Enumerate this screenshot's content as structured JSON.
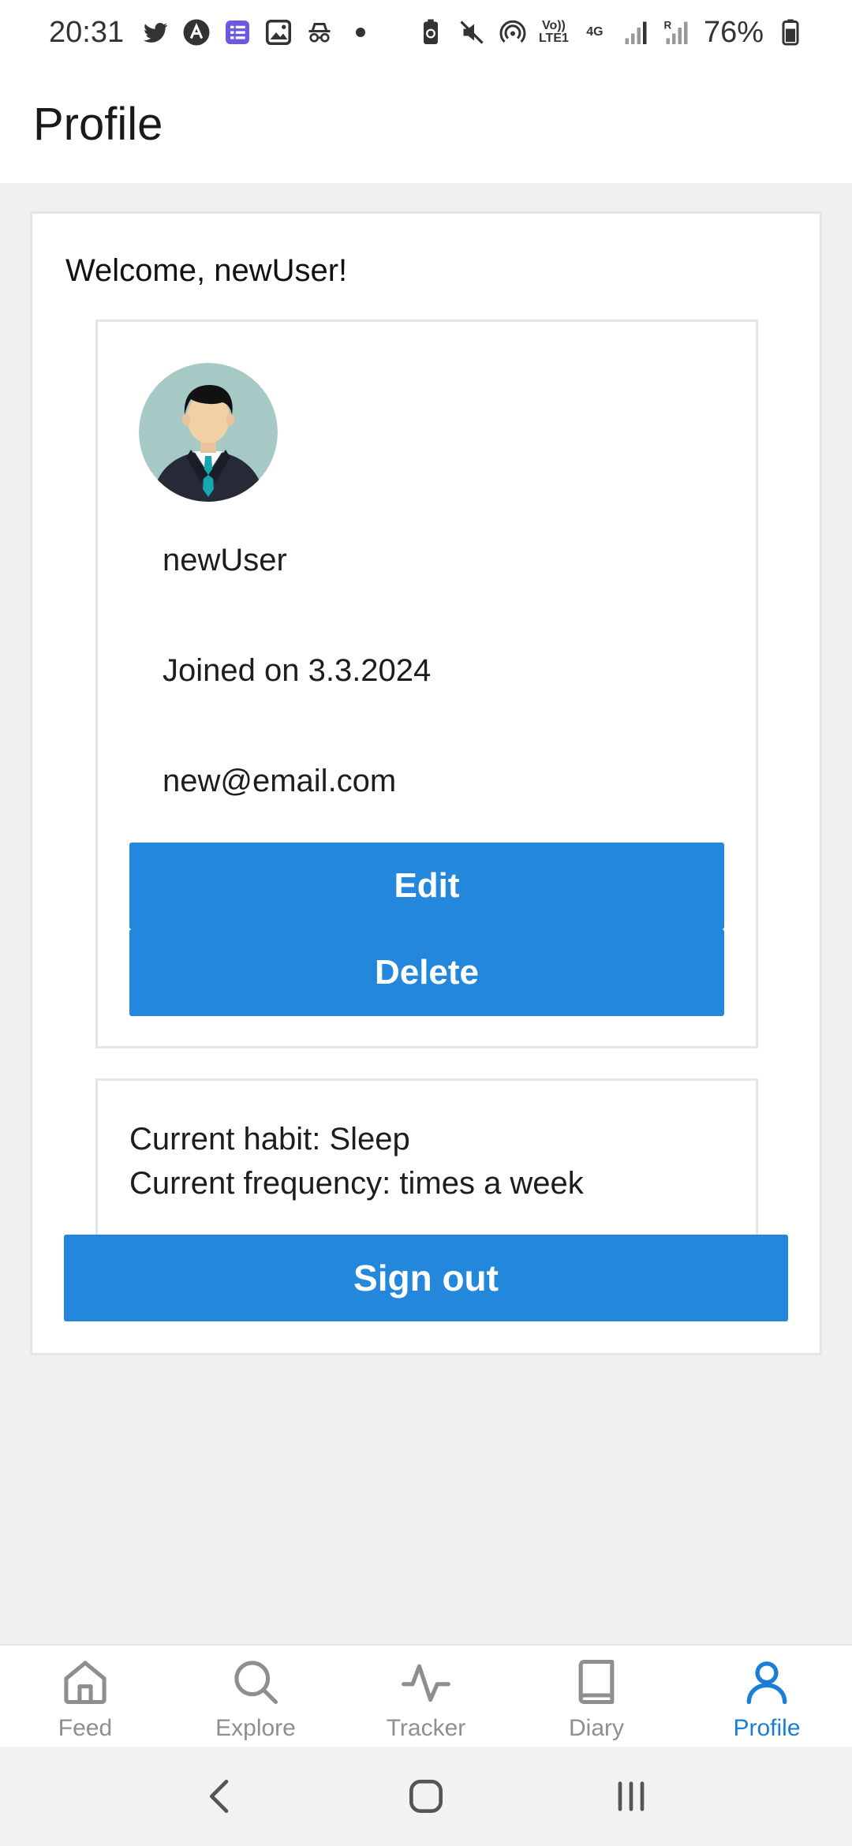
{
  "status_bar": {
    "time": "20:31",
    "battery": "76%",
    "left_icons": [
      "twitter-icon",
      "app-a-icon",
      "tasks-icon",
      "gallery-icon",
      "incognito-icon",
      "dot-icon"
    ],
    "right_icons": [
      "battery-saver-icon",
      "mute-icon",
      "hotspot-icon",
      "volte-icon",
      "4g-icon",
      "signal-icon",
      "roaming-signal-icon",
      "battery-icon"
    ],
    "volte_label": "Vo)) LTE1",
    "network_label": "4G",
    "roaming_label": "R"
  },
  "header": {
    "title": "Profile"
  },
  "main": {
    "welcome": "Welcome, newUser!",
    "profile": {
      "username": "newUser",
      "joined": "Joined on 3.3.2024",
      "email": "new@email.com",
      "edit_label": "Edit",
      "delete_label": "Delete"
    },
    "habit": {
      "current_habit": "Current habit: Sleep",
      "current_frequency": "Current frequency:  times a week"
    },
    "sign_out_label": "Sign out"
  },
  "tabs": [
    {
      "label": "Feed",
      "icon": "home-icon",
      "active": false
    },
    {
      "label": "Explore",
      "icon": "search-icon",
      "active": false
    },
    {
      "label": "Tracker",
      "icon": "activity-icon",
      "active": false
    },
    {
      "label": "Diary",
      "icon": "book-icon",
      "active": false
    },
    {
      "label": "Profile",
      "icon": "user-icon",
      "active": true
    }
  ],
  "colors": {
    "accent": "#2388dc",
    "active_tab": "#1a7fd4",
    "inactive_tab": "#8e8e8e",
    "background": "#f0f0f0"
  }
}
